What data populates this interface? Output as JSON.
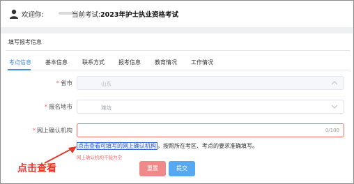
{
  "header": {
    "welcome": "欢迎你:",
    "exam_label": "当前考试:",
    "exam_name": "2023年护士执业资格考试"
  },
  "section_title": "填写报考信息",
  "tabs": [
    {
      "label": "考点信息",
      "active": true
    },
    {
      "label": "基本信息",
      "active": false
    },
    {
      "label": "联系方式",
      "active": false
    },
    {
      "label": "报考信息",
      "active": false
    },
    {
      "label": "教育情况",
      "active": false
    },
    {
      "label": "工作情况",
      "active": false
    }
  ],
  "form": {
    "province_label": "省市",
    "province_value": "山东",
    "city_label": "报名地市",
    "city_value": "潍坊",
    "org_label": "网上确认机构",
    "org_counter": "0/100",
    "link_text": "点击查看可填写的网上确认机构",
    "link_suffix": "，按照所在考区、考点的要求准确填写。",
    "error": "网上确认机构不能为空"
  },
  "annotation": "点击查看",
  "buttons": {
    "reset": "重置",
    "submit": "提交"
  },
  "colors": {
    "accent": "#3a8ee6",
    "error": "#f56c6c",
    "annotation": "#e03a2f"
  }
}
